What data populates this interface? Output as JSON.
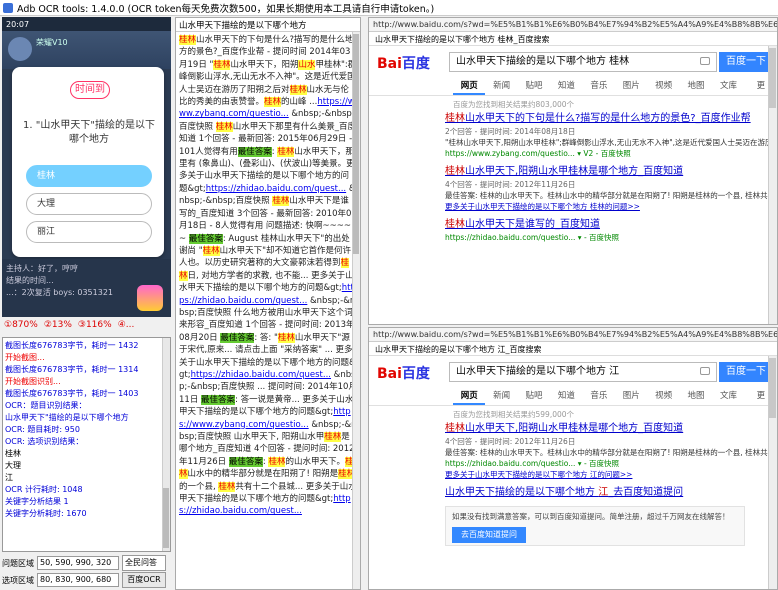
{
  "window": {
    "title": "Adb OCR tools: 1.4.0.0 (OCR token每天免费次数500，如果长期使用本工具请自行申请token。)"
  },
  "phone": {
    "status_time": "20:07",
    "status_right": "",
    "top_name": "荣耀V10",
    "timer": "时间到",
    "question": "1. \"山水甲天下\"描绘的是以下哪个地方",
    "options": [
      "桂林",
      "大理",
      "丽江"
    ],
    "bottom_lines": [
      "主持人：好了，哼哼",
      "结果的时间...",
      "...：2次复活 boys: 0351321"
    ]
  },
  "stats": {
    "a": "①870%",
    "b": "②13%",
    "c": "③116%",
    "d": "④..."
  },
  "log": {
    "lines": [
      {
        "t": "截图长度676783字节，耗时一 1432",
        "c": "blue"
      },
      {
        "t": "",
        "c": ""
      },
      {
        "t": "开始截图...",
        "c": "red"
      },
      {
        "t": "截图长度676783字节，耗时一 1314",
        "c": "blue"
      },
      {
        "t": "",
        "c": ""
      },
      {
        "t": "开始截图识别...",
        "c": "red"
      },
      {
        "t": "截图长度676783字节，耗时一 1403",
        "c": "blue"
      },
      {
        "t": "OCR：题目识别结果：",
        "c": "blue"
      },
      {
        "t": "山水甲天下\"描绘的是以下哪个地方",
        "c": "blue"
      },
      {
        "t": "OCR: 题目耗时: 950",
        "c": "blue"
      },
      {
        "t": "",
        "c": ""
      },
      {
        "t": "OCR: 选项识别结果：",
        "c": "blue"
      },
      {
        "t": "桂林",
        "c": ""
      },
      {
        "t": "大理",
        "c": ""
      },
      {
        "t": "江",
        "c": ""
      },
      {
        "t": "OCR 计行耗时: 1048",
        "c": "blue"
      },
      {
        "t": "",
        "c": ""
      },
      {
        "t": "关键字分析结果  1",
        "c": "blue"
      },
      {
        "t": "关键字分析耗时: 1670",
        "c": "blue"
      }
    ]
  },
  "controls": {
    "q_label": "问题区域",
    "q_value": "50, 590, 990, 320",
    "opt_label": "选项区域",
    "opt_value": "80, 830, 900, 680",
    "mode_select": "全民问答",
    "ocr_button": "百度OCR"
  },
  "mid": {
    "header": "山水甲天下描绘的是以下哪个地方",
    "body": [
      {
        "t": "桂林",
        "s": "hl-red"
      },
      {
        "t": "山水甲天下的下句是什么?描写的是什么地方的景色?_百度作业帮 - 提问时间 2014年03月19日 \"",
        "s": ""
      },
      {
        "t": "桂林",
        "s": "hl-red"
      },
      {
        "t": "山水甲天下，阳朔",
        "s": ""
      },
      {
        "t": "山水",
        "s": "hl-red"
      },
      {
        "t": "甲桂林\":群峰倒影山浮水,无山无水不入神\"。这是近代爱国人士吴迈在游历了阳朔之后对",
        "s": ""
      },
      {
        "t": "桂林",
        "s": "hl-red"
      },
      {
        "t": "山水无与伦比的秀美的由衷赞誉。",
        "s": ""
      },
      {
        "t": "桂林",
        "s": "hl-red"
      },
      {
        "t": "的山峰 ...",
        "s": ""
      },
      {
        "t": "https://www.zybang.com/questio...",
        "s": "link"
      },
      {
        "t": " &nbsp;-&nbsp;百度快照 ",
        "s": ""
      },
      {
        "t": "桂林",
        "s": "hl-red"
      },
      {
        "t": "山水甲天下那里有什么美景_百度知道 1个回答 - 最新回答: 2015年06月29日 - 101人觉得有用",
        "s": ""
      },
      {
        "t": "最佳答案",
        "s": "hl-g"
      },
      {
        "t": ": ",
        "s": ""
      },
      {
        "t": "桂林",
        "s": "hl-red"
      },
      {
        "t": "山水甲天下，那里有 (象鼻山)、(叠彩山)、(伏波山)等美景。更多关于山水甲天下描绘的是以下哪个地方的问题&gt;",
        "s": ""
      },
      {
        "t": "https://zhidao.baidu.com/quest...",
        "s": "link"
      },
      {
        "t": " &nbsp;-&nbsp;百度快照 ",
        "s": ""
      },
      {
        "t": "桂林",
        "s": "hl-red"
      },
      {
        "t": "山水甲天下是谁写的_百度知道 3个回答 - 最新回答: 2010年05月18日 - 8人觉得有用 问题描述: 快啊~~~~~ ",
        "s": ""
      },
      {
        "t": "最佳答案",
        "s": "hl-g"
      },
      {
        "t": ": August 桂林山水甲天下\"的出处 谢尚 \"",
        "s": ""
      },
      {
        "t": "桂林",
        "s": "hl-red"
      },
      {
        "t": "山水甲天下\"却不知道它首作是何许人也。以历史研究著称的大文豪郭沫若得到",
        "s": ""
      },
      {
        "t": "桂林",
        "s": "hl-red"
      },
      {
        "t": "日, 对地方学者的求教, 也不能... 更多关于山水甲天下描绘的是以下哪个地方的问题&gt;",
        "s": ""
      },
      {
        "t": "https://zhidao.baidu.com/quest...",
        "s": "link"
      },
      {
        "t": " &nbsp;-&nbsp;百度快照 ",
        "s": ""
      },
      {
        "t": "什么地方被用山水甲天下这个词来形容_百度知道 1个回答 - 提问时间: 2013年08月20日 ",
        "s": ""
      },
      {
        "t": "最佳答案",
        "s": "hl-g"
      },
      {
        "t": ": 答: \"",
        "s": ""
      },
      {
        "t": "桂林",
        "s": "hl-red"
      },
      {
        "t": "山水甲天下\"源于宋代,原来... 请点击上面 \"采纳答案\" ... 更多关于山水甲天下描绘的是以下哪个地方的问题&gt;",
        "s": ""
      },
      {
        "t": "https://zhidao.baidu.com/quest...",
        "s": "link"
      },
      {
        "t": " &nbsp;-&nbsp;百度快照 ",
        "s": ""
      },
      {
        "t": "... 提问时间: 2014年10月11日 ",
        "s": ""
      },
      {
        "t": "最佳答案",
        "s": "hl-g"
      },
      {
        "t": ": 答一说是黄帝... 更多关于山水甲天下描绘的是以下哪个地方的问题&gt;",
        "s": ""
      },
      {
        "t": "https://www.zybang.com/questio...",
        "s": "link"
      },
      {
        "t": " &nbsp;-&nbsp;百度快照 ",
        "s": ""
      },
      {
        "t": "山水甲天下, 阳朔山水甲",
        "s": ""
      },
      {
        "t": "桂林",
        "s": "hl-red"
      },
      {
        "t": "是哪个地方_百度知道 4个回答 - 提问时间: 2012年11月26日 ",
        "s": ""
      },
      {
        "t": "最佳答案",
        "s": "hl-g"
      },
      {
        "t": ": ",
        "s": ""
      },
      {
        "t": "桂林",
        "s": "hl-red"
      },
      {
        "t": "的山水甲天下。",
        "s": ""
      },
      {
        "t": "桂林",
        "s": "hl-red"
      },
      {
        "t": "山水中的精华部分就是在阳朔了! 阳朔是",
        "s": ""
      },
      {
        "t": "桂林",
        "s": "hl-red"
      },
      {
        "t": "的一个县, ",
        "s": ""
      },
      {
        "t": "桂林",
        "s": "hl-red"
      },
      {
        "t": "共有十二个县城... 更多关于山水甲天下描绘的是以下哪个地方的问题&gt;",
        "s": ""
      },
      {
        "t": "https://zhidao.baidu.com/quest...",
        "s": "link"
      }
    ]
  },
  "browser1": {
    "url": "http://www.baidu.com/s?wd=%E5%B1%B1%E6%B0%B4%E7%94%B2%E5%A4%A9%E4%B8%8B%E6%8F%8F%E7%BB%98%E7%9A%84",
    "tab": "山水甲天下描绘的是以下哪个地方 桂林_百度搜索",
    "logo_bai": "Bai",
    "logo_du": "百度",
    "query": "山水甲天下描绘的是以下哪个地方 桂林",
    "search_button": "百度一下",
    "nav": [
      "网页",
      "新闻",
      "贴吧",
      "知道",
      "音乐",
      "图片",
      "视频",
      "地图",
      "文库",
      "更"
    ],
    "count": "百度为您找到相关结果约803,000个",
    "results": [
      {
        "title_pre": "",
        "title_em": "桂林",
        "title_post": "山水甲天下的下句是什么?描写的是什么地方的景色?_百度作业帮",
        "meta": "2个回答 - 提问时间: 2014年08月18日",
        "desc": "\"桂林山水甲天下,阳朔山水甲桂林\";群峰倒影山浮水,无山无水不入神\",这是近代爱国人士吴迈在游历了阳朔之后对桂林山水无与伦比的秀美的由衷赞誉。桂林的山峰 ...",
        "url": "https://www.zybang.com/questio... ▾ V2 - 百度快照",
        "more": ""
      },
      {
        "title_pre": "",
        "title_em": "桂林",
        "title_post": "山水甲天下,阳朔山水甲桂林是哪个地方_百度知道",
        "meta": "4个回答 - 提问时间: 2012年11月26日",
        "desc": "最佳答案: 桂林的山水甲天下。桂林山水中的精华部分就是在阳朔了! 阳朔是桂林的一个县, 桂林共有十二个县城。比较好玩的还有兴安的灵渠、乐满地。龙胜的梯田和...",
        "url": "",
        "more": "更多关于山水甲天下描绘的是以下哪个地方 桂林的问题>>"
      },
      {
        "title_pre": "",
        "title_em": "桂林",
        "title_post": "山水甲天下是谁写的_百度知道",
        "meta": "",
        "desc": "",
        "url": "https://zhidao.baidu.com/questio... ▾ - 百度快照",
        "more": ""
      }
    ]
  },
  "browser2": {
    "url": "http://www.baidu.com/s?wd=%E5%B1%B1%E6%B0%B4%E7%94%B2%E5%A4%A9%E4%B8%8B%E6%8F%8F%E7%BB%98%E7%9A%84",
    "tab": "山水甲天下描绘的是以下哪个地方 江_百度搜索",
    "logo_bai": "Bai",
    "logo_du": "百度",
    "query": "山水甲天下描绘的是以下哪个地方 江",
    "search_button": "百度一下",
    "nav": [
      "网页",
      "新闻",
      "贴吧",
      "知道",
      "音乐",
      "图片",
      "视频",
      "地图",
      "文库",
      "更"
    ],
    "count": "百度为您找到相关结果约599,000个",
    "results": [
      {
        "title_pre": "",
        "title_em": "桂林",
        "title_post": "山水甲天下,阳朔山水甲桂林是哪个地方_百度知道",
        "meta": "4个回答 - 提问时间: 2012年11月26日",
        "desc": "最佳答案: 桂林的山水甲天下。桂林山水中的精华部分就是在阳朔了! 阳朔是桂林的一个县, 桂林共有十二个县城。比较好玩的还有兴安的灵渠、乐满地。龙胜的梯田和...",
        "url": "https://zhidao.baidu.com/questio... ▾ - 百度快照",
        "more": "更多关于山水甲天下描绘的是以下哪个地方 江的问题>>"
      },
      {
        "title_pre": "山水甲天下描绘的是以下哪个地方 ",
        "title_em": "江",
        "title_post": "_去百度知道提问",
        "meta": "",
        "desc": "",
        "url": "",
        "more": ""
      }
    ],
    "ask_text": "如果没有找到满意答案，可以到百度知道提问。简单注册，超过千万网友在线解答！",
    "ask_button": "去百度知道提问"
  }
}
